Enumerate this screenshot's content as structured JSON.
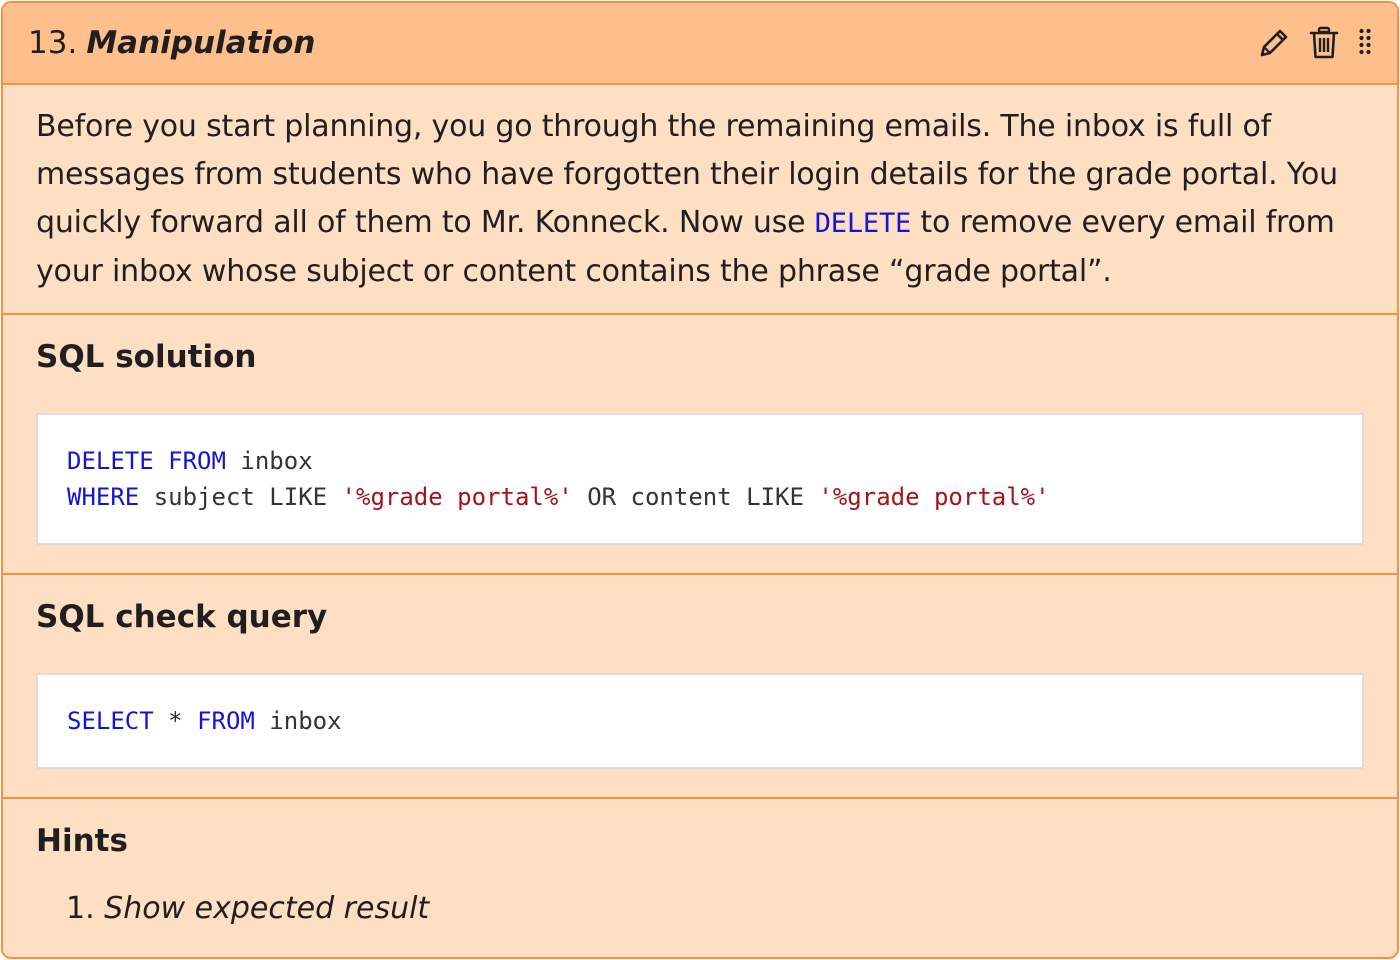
{
  "task": {
    "number": "13.",
    "name": "Manipulation"
  },
  "actions": {
    "edit_icon": "pencil-icon",
    "delete_icon": "trash-icon",
    "drag_icon": "drag-handle-icon"
  },
  "description": {
    "text_before": "Before you start planning, you go through the remaining emails. The inbox is full of messages from students who have forgotten their login details for the grade portal. You quickly forward all of them to Mr. Konneck. Now use ",
    "code": "DELETE",
    "text_after": " to remove every email from your inbox whose subject or content contains the phrase “grade portal”."
  },
  "solution": {
    "title": "SQL solution",
    "line1": {
      "kw1": "DELETE",
      "kw2": "FROM",
      "rest": "inbox"
    },
    "line2": {
      "kw1": "WHERE",
      "mid1": "subject LIKE",
      "str1": "'%grade portal%'",
      "mid2": "OR content LIKE",
      "str2": "'%grade portal%'"
    }
  },
  "check": {
    "title": "SQL check query",
    "kw1": "SELECT",
    "star": "*",
    "kw2": "FROM",
    "rest": "inbox"
  },
  "hints": {
    "title": "Hints",
    "items": [
      {
        "number": "1.",
        "label": "Show expected result"
      }
    ]
  },
  "colors": {
    "header_bg": "#ffbf8d",
    "card_bg": "#ffdfc3",
    "border": "#f5913e",
    "keyword": "#1414d2",
    "string": "#a3141a"
  }
}
